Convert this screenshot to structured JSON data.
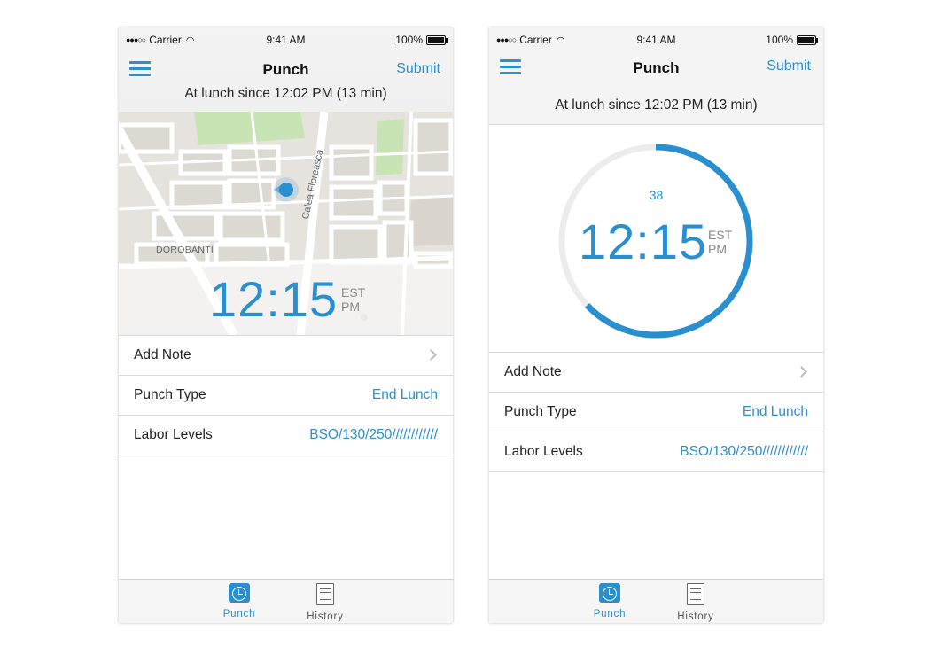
{
  "status_bar": {
    "carrier": "Carrier",
    "time": "9:41 AM",
    "battery": "100%"
  },
  "header": {
    "title": "Punch",
    "submit_label": "Submit",
    "lunch_status": "At lunch since 12:02 PM (13 min)"
  },
  "clock": {
    "time": "12:15",
    "tz": "EST",
    "ampm": "PM",
    "seconds": "38"
  },
  "map": {
    "street_label": "Calea Floreasca",
    "district_label": "DOROBANTI"
  },
  "rows": [
    {
      "label": "Add Note",
      "value": ""
    },
    {
      "label": "Punch Type",
      "value": "End Lunch"
    },
    {
      "label": "Labor Levels",
      "value": "BSO/130/250////////////"
    }
  ],
  "tabs": {
    "punch": "Punch",
    "history": "History"
  },
  "ring": {
    "progress": 0.63
  },
  "colors": {
    "accent": "#2a8fce",
    "map_road": "#ffffff",
    "map_park": "#bfe0a8",
    "map_block": "#dcd8d2"
  }
}
